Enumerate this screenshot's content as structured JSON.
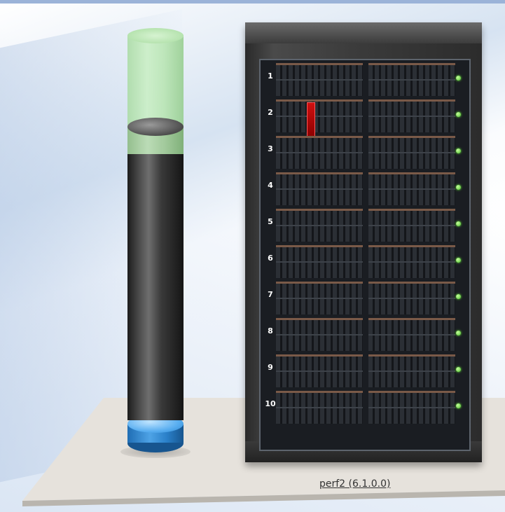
{
  "system": {
    "label": "perf2 (6.1.0.0)"
  },
  "rack": {
    "unit_labels": [
      "1",
      "2",
      "3",
      "4",
      "5",
      "6",
      "7",
      "8",
      "9",
      "10"
    ],
    "led_color": "#4cbf2c",
    "alert_color": "#c00000",
    "alert_unit": "2"
  },
  "capacity_cylinder": {
    "segments": [
      "green",
      "dark",
      "blue"
    ],
    "colors": {
      "green": "#b7e5b0",
      "dark": "#3a3a3a",
      "blue": "#4ea3e6"
    }
  }
}
